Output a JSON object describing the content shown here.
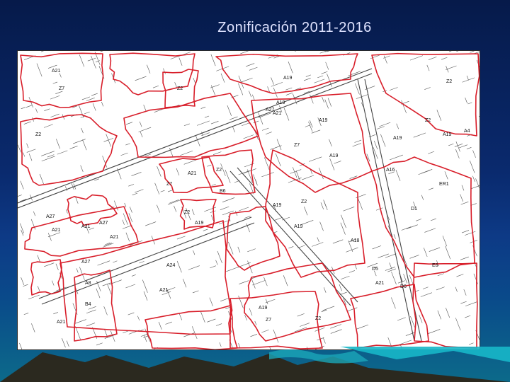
{
  "slide": {
    "title": "Zonificación 2011-2016"
  },
  "colors": {
    "zone_boundary": "#d81e2a",
    "street_line": "#555555",
    "background": "#0a2a6e",
    "map_bg": "#ffffff"
  },
  "map": {
    "labels": [
      "A21",
      "A21",
      "A21",
      "A21",
      "A21",
      "A21",
      "A21",
      "A21",
      "A21",
      "A27",
      "A27",
      "A27",
      "A27",
      "Z2",
      "Z2",
      "Z2",
      "Z2",
      "Z2",
      "Z2",
      "Z2",
      "Z2",
      "Z7",
      "Z7",
      "Z7",
      "Z7",
      "A19",
      "A19",
      "A19",
      "A19",
      "A19",
      "A19",
      "A19",
      "A19",
      "A19",
      "A19",
      "A24",
      "A8",
      "A16",
      "A18",
      "B6",
      "B4",
      "D1",
      "D5",
      "D6",
      "E6",
      "ER1",
      "A4"
    ]
  }
}
